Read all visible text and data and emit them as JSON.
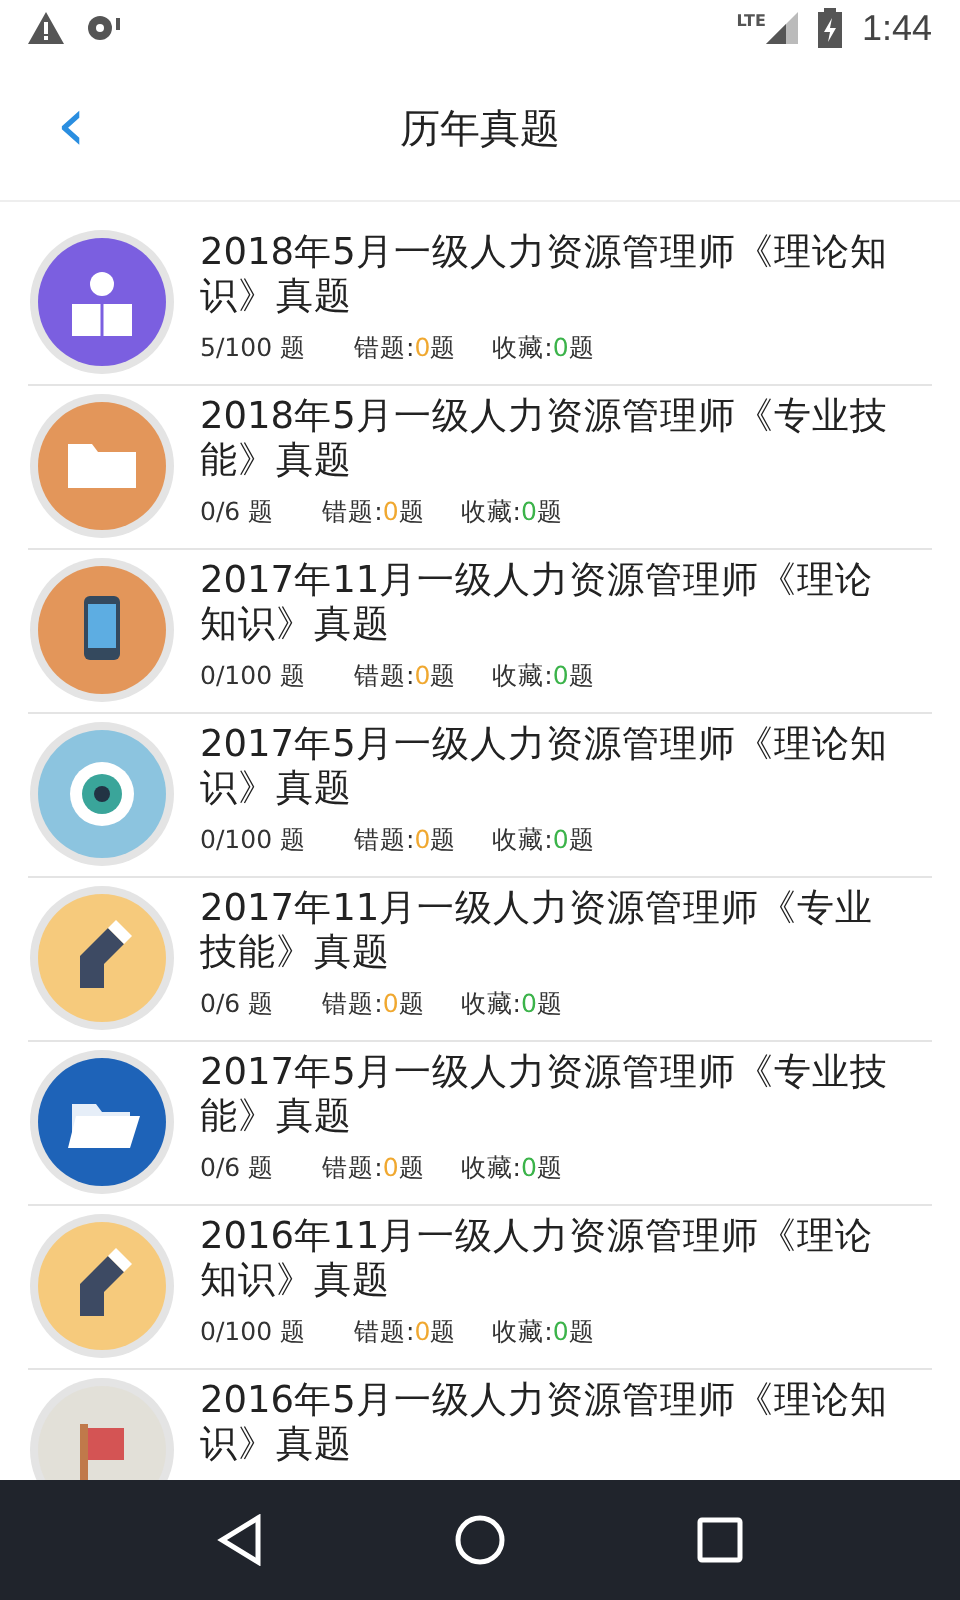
{
  "status_bar": {
    "network": "LTE",
    "time": "1:44"
  },
  "header": {
    "back": "‹",
    "title": "历年真题"
  },
  "exams": [
    {
      "kind": "reader",
      "color": "#7b5fe0",
      "title": "2018年5月一级人力资源管理师《理论知识》真题",
      "progress": "5/100 题",
      "wrong": {
        "label": "错题:",
        "count": "0",
        "unit": "题"
      },
      "favorite": {
        "label": "收藏:",
        "count": "0",
        "unit": "题"
      }
    },
    {
      "kind": "folder",
      "color": "#e3965a",
      "title": "2018年5月一级人力资源管理师《专业技能》真题",
      "progress": "0/6 题",
      "wrong": {
        "label": "错题:",
        "count": "0",
        "unit": "题"
      },
      "favorite": {
        "label": "收藏:",
        "count": "0",
        "unit": "题"
      }
    },
    {
      "kind": "phone",
      "color": "#e3965a",
      "title": "2017年11月一级人力资源管理师《理论知识》真题",
      "progress": "0/100 题",
      "wrong": {
        "label": "错题:",
        "count": "0",
        "unit": "题"
      },
      "favorite": {
        "label": "收藏:",
        "count": "0",
        "unit": "题"
      }
    },
    {
      "kind": "eye",
      "color": "#8cc4df",
      "title": "2017年5月一级人力资源管理师《理论知识》真题",
      "progress": "0/100 题",
      "wrong": {
        "label": "错题:",
        "count": "0",
        "unit": "题"
      },
      "favorite": {
        "label": "收藏:",
        "count": "0",
        "unit": "题"
      }
    },
    {
      "kind": "pencil",
      "color": "#f6ca7c",
      "title": "2017年11月一级人力资源管理师《专业技能》真题",
      "progress": "0/6 题",
      "wrong": {
        "label": "错题:",
        "count": "0",
        "unit": "题"
      },
      "favorite": {
        "label": "收藏:",
        "count": "0",
        "unit": "题"
      }
    },
    {
      "kind": "folder-open",
      "color": "#1e63b8",
      "title": "2017年5月一级人力资源管理师《专业技能》真题",
      "progress": "0/6 题",
      "wrong": {
        "label": "错题:",
        "count": "0",
        "unit": "题"
      },
      "favorite": {
        "label": "收藏:",
        "count": "0",
        "unit": "题"
      }
    },
    {
      "kind": "pencil",
      "color": "#f6ca7c",
      "title": "2016年11月一级人力资源管理师《理论知识》真题",
      "progress": "0/100 题",
      "wrong": {
        "label": "错题:",
        "count": "0",
        "unit": "题"
      },
      "favorite": {
        "label": "收藏:",
        "count": "0",
        "unit": "题"
      }
    },
    {
      "kind": "flag",
      "color": "#e2e0d8",
      "title": "2016年5月一级人力资源管理师《理论知识》真题"
    }
  ]
}
